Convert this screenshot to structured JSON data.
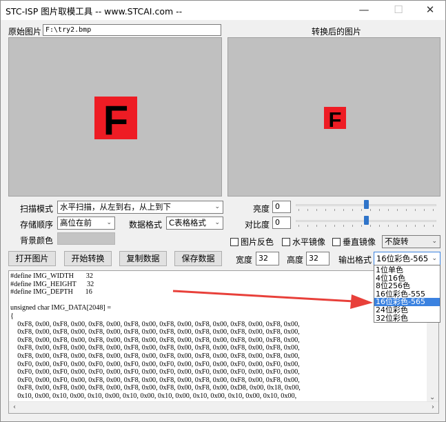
{
  "window": {
    "title": "STC-ISP 图片取模工具 -- www.STCAI.com --",
    "minimize_icon": "—",
    "maximize_icon": "☐",
    "close_icon": "✕"
  },
  "original": {
    "label": "原始图片",
    "path": "F:\\try2.bmp",
    "glyph": "F",
    "colors": {
      "background": "#ee1c24",
      "glyph": "#000000"
    }
  },
  "converted": {
    "label": "转换后的图片",
    "glyph": "F"
  },
  "scan_mode": {
    "label": "扫描模式",
    "value": "水平扫描，从左到右，从上到下"
  },
  "storage_order": {
    "label": "存储顺序",
    "value": "高位在前"
  },
  "data_format": {
    "label": "数据格式",
    "value": "C表格格式"
  },
  "background_color": {
    "label": "背景颜色"
  },
  "brightness": {
    "label": "亮度",
    "value": "0",
    "level": 0.5
  },
  "contrast": {
    "label": "对比度",
    "value": "0",
    "level": 0.5
  },
  "options": {
    "invert": "图片反色",
    "hmirror": "水平镜像",
    "vmirror": "垂直镜像",
    "rotate": "不旋转"
  },
  "buttons": {
    "open": "打开图片",
    "convert": "开始转换",
    "copy": "复制数据",
    "save": "保存数据"
  },
  "size": {
    "width_label": "宽度",
    "width": "32",
    "height_label": "高度",
    "height": "32"
  },
  "output_format": {
    "label": "输出格式",
    "value": "16位彩色-565",
    "options": [
      "1位单色",
      "4位16色",
      "8位256色",
      "16位彩色-555",
      "16位彩色-565",
      "24位彩色",
      "32位彩色"
    ],
    "selected_index": 4
  },
  "code": {
    "lines": [
      "#define IMG_WIDTH       32",
      "#define IMG_HEIGHT      32",
      "#define IMG_DEPTH       16",
      "",
      "unsigned char IMG_DATA[2048] =",
      "{",
      "    0xF8, 0x00, 0xF8, 0x00, 0xF8, 0x00, 0xF8, 0x00, 0xF8, 0x00, 0xF8, 0x00, 0xF8, 0x00, 0xF8, 0x00,",
      "    0xF8, 0x00, 0xF8, 0x00, 0xF8, 0x00, 0xF8, 0x00, 0xF8, 0x00, 0xF8, 0x00, 0xF8, 0x00, 0xF8, 0x00,",
      "    0xF8, 0x00, 0xF8, 0x00, 0xF8, 0x00, 0xF8, 0x00, 0xF8, 0x00, 0xF8, 0x00, 0xF8, 0x00, 0xF8, 0x00,",
      "    0xF8, 0x00, 0xF8, 0x00, 0xF8, 0x00, 0xF8, 0x00, 0xF8, 0x00, 0xF8, 0x00, 0xF8, 0x00, 0xF8, 0x00,",
      "    0xF8, 0x00, 0xF8, 0x00, 0xF8, 0x00, 0xF8, 0x00, 0xF8, 0x00, 0xF8, 0x00, 0xF8, 0x00, 0xF8, 0x00,",
      "    0xF0, 0x00, 0xF0, 0x00, 0xF0, 0x00, 0xF0, 0x00, 0xF0, 0x00, 0xF0, 0x00, 0xF0, 0x00, 0xF0, 0x00,",
      "    0xF0, 0x00, 0xF0, 0x00, 0xF0, 0x00, 0xF0, 0x00, 0xF0, 0x00, 0xF0, 0x00, 0xF0, 0x00, 0xF0, 0x00,",
      "    0xF0, 0x00, 0xF0, 0x00, 0xF8, 0x00, 0xF8, 0x00, 0xF8, 0x00, 0xF8, 0x00, 0xF8, 0x00, 0xF8, 0x00,",
      "    0xF8, 0x00, 0xF8, 0x00, 0xF8, 0x00, 0xF8, 0x00, 0xF8, 0x00, 0xF8, 0x00, 0xD8, 0x00, 0x18, 0x00,",
      "    0x10, 0x00, 0x10, 0x00, 0x10, 0x00, 0x10, 0x00, 0x10, 0x00, 0x10, 0x00, 0x10, 0x00, 0x10, 0x00,"
    ]
  },
  "colors": {
    "arrow": "#e8403a",
    "selection": "#3b82e0",
    "slider_thumb": "#2f74c9"
  }
}
